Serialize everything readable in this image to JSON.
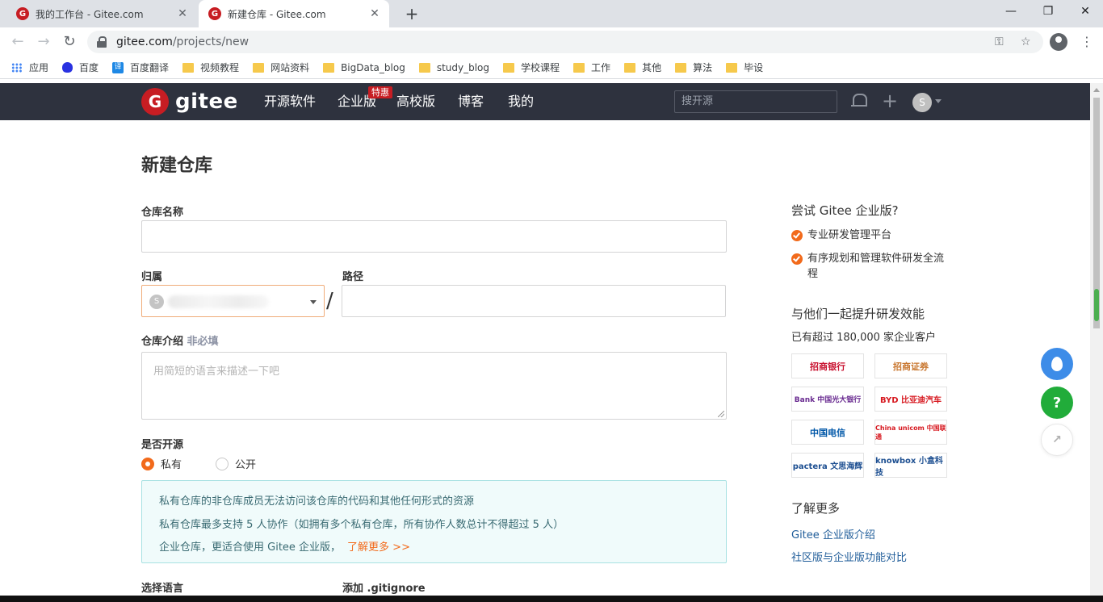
{
  "browser": {
    "tabs": [
      {
        "title": "我的工作台 - Gitee.com",
        "favicon": "G"
      },
      {
        "title": "新建仓库 - Gitee.com",
        "favicon": "G"
      }
    ],
    "url_host": "gitee.com",
    "url_path": "/projects/new",
    "bookmarks": [
      {
        "label": "应用",
        "icon": "apps-icon"
      },
      {
        "label": "百度",
        "icon": "baidu-icon"
      },
      {
        "label": "百度翻译",
        "icon": "fanyi-icon",
        "glyph": "译"
      },
      {
        "label": "视频教程",
        "icon": "folder-icon"
      },
      {
        "label": "网站资料",
        "icon": "folder-icon"
      },
      {
        "label": "BigData_blog",
        "icon": "folder-icon"
      },
      {
        "label": "study_blog",
        "icon": "folder-icon"
      },
      {
        "label": "学校课程",
        "icon": "folder-icon"
      },
      {
        "label": "工作",
        "icon": "folder-icon"
      },
      {
        "label": "其他",
        "icon": "folder-icon"
      },
      {
        "label": "算法",
        "icon": "folder-icon"
      },
      {
        "label": "毕设",
        "icon": "folder-icon"
      }
    ]
  },
  "header": {
    "logo_text": "gitee",
    "logo_mark": "G",
    "nav": [
      "开源软件",
      "企业版",
      "高校版",
      "博客",
      "我的"
    ],
    "badge": "特惠",
    "search_placeholder": "搜开源",
    "avatar_letter": "S"
  },
  "form": {
    "title": "新建仓库",
    "repo_name_label": "仓库名称",
    "owner_label": "归属",
    "owner_avatar": "S",
    "path_label": "路径",
    "slash": "/",
    "desc_label": "仓库介绍",
    "desc_optional": "非必填",
    "desc_placeholder": "用简短的语言来描述一下吧",
    "open_label": "是否开源",
    "private_label": "私有",
    "public_label": "公开",
    "notice": [
      "私有仓库的非仓库成员无法访问该仓库的代码和其他任何形式的资源",
      "私有仓库最多支持 5 人协作（如拥有多个私有仓库，所有协作人数总计不得超过 5 人）",
      "企业仓库，更适合使用 Gitee 企业版，"
    ],
    "notice_link": "了解更多 >>",
    "language_label": "选择语言",
    "gitignore_label": "添加 .gitignore"
  },
  "sidebar": {
    "try_title": "尝试 Gitee 企业版?",
    "features": [
      "专业研发管理平台",
      "有序规划和管理软件研发全流程"
    ],
    "boost_title": "与他们一起提升研发效能",
    "customers": "已有超过 180,000 家企业客户",
    "logos": [
      "招商银行",
      "招商证券",
      "Bank 中国光大银行",
      "BYD 比亚迪汽车",
      "中国电信",
      "China unicom 中国联通",
      "pactera 文思海辉",
      "knowbox 小盒科技"
    ],
    "more_title": "了解更多",
    "links": [
      "Gitee 企业版介绍",
      "社区版与企业版功能对比"
    ]
  },
  "colors": {
    "brand": "#c71d23",
    "accent": "#f26a1b",
    "header_bg": "#2e323e"
  }
}
